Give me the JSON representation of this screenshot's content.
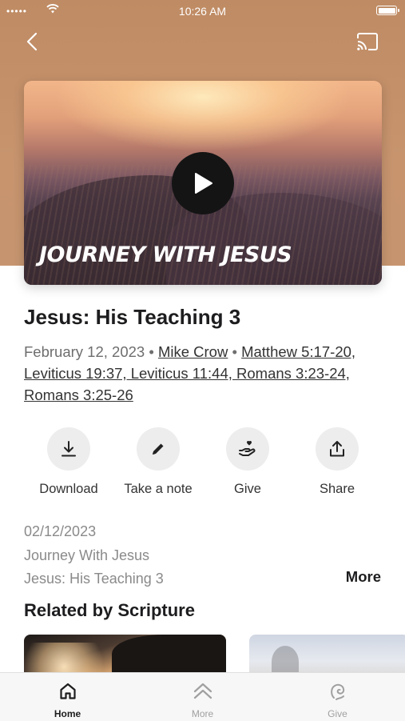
{
  "status_bar": {
    "signal": "•••••",
    "time": "10:26 AM"
  },
  "hero": {
    "title": "JOURNEY WITH JESUS"
  },
  "sermon": {
    "title": "Jesus: His Teaching 3",
    "date": "February 12, 2023",
    "separator": " • ",
    "speaker": "Mike Crow",
    "scriptures": "Matthew 5:17-20, Leviticus 19:37, Leviticus 11:44, Romans 3:23-24, Romans 3:25-26"
  },
  "actions": [
    {
      "label": "Download",
      "icon": "download-icon"
    },
    {
      "label": "Take a note",
      "icon": "pencil-icon"
    },
    {
      "label": "Give",
      "icon": "give-icon"
    },
    {
      "label": "Share",
      "icon": "share-icon"
    }
  ],
  "details": {
    "date": "02/12/2023",
    "series": "Journey With Jesus",
    "title": "Jesus: His Teaching 3",
    "more_label": "More"
  },
  "related": {
    "heading": "Related by Scripture"
  },
  "tabbar": {
    "tabs": [
      {
        "label": "Home",
        "icon": "home-icon",
        "active": true
      },
      {
        "label": "More",
        "icon": "chevrons-up-icon",
        "active": false
      },
      {
        "label": "Give",
        "icon": "give-tab-icon",
        "active": false
      }
    ],
    "active_color": "#1d1d1f",
    "inactive_color": "#a0a0a0"
  },
  "colors": {
    "header_bg": "#c69570",
    "accent_text": "#1d1d1f"
  }
}
